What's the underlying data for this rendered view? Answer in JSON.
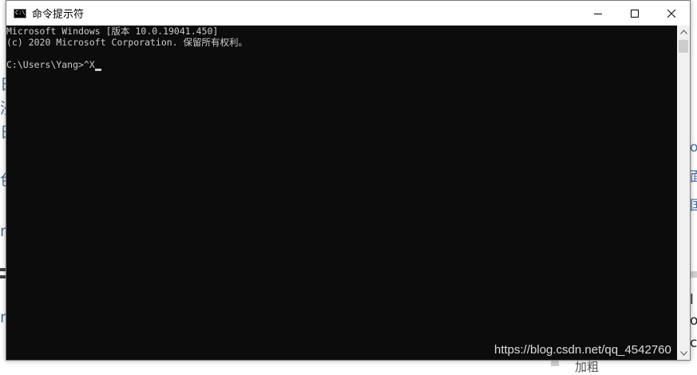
{
  "window": {
    "title": "命令提示符",
    "icon": "console-icon",
    "icon_text": "C:\\"
  },
  "controls": {
    "minimize": "minimize-icon",
    "maximize": "maximize-icon",
    "close": "close-icon"
  },
  "console": {
    "lines": [
      "Microsoft Windows [版本 10.0.19041.450]",
      "(c) 2020 Microsoft Corporation. 保留所有权利。",
      "",
      "C:\\Users\\Yang>^X"
    ],
    "text_color": "#cccccc",
    "background": "#0c0c0c"
  },
  "background_page": {
    "left_fragments": [
      "日",
      "浸",
      "日",
      "",
      "色",
      "",
      "ri",
      "",
      "ri"
    ],
    "right_fragments": [
      "o",
      "面",
      "国",
      "l",
      "o",
      "c"
    ],
    "bottom_fragment": "加粗"
  },
  "watermark": "https://blog.csdn.net/qq_4542760"
}
